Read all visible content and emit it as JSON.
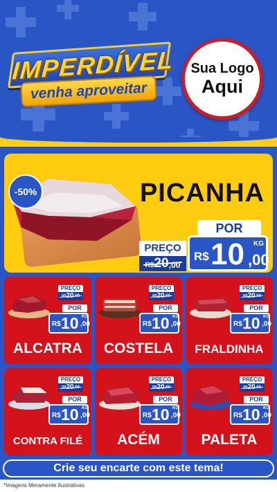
{
  "header": {
    "brand_title": "IMPERDÍVEL",
    "brand_subtitle": "venha aproveitar",
    "logo_line1": "Sua Logo",
    "logo_line2": "Aqui"
  },
  "featured": {
    "name": "PICANHA",
    "discount": "-50%",
    "price_label": "PREÇO",
    "old_currency": "R$",
    "old_integer": "20",
    "old_decimal": ",00",
    "por_label": "POR",
    "new_currency": "R$",
    "new_integer": "10",
    "new_decimal": ",00",
    "unit": "KG"
  },
  "products": [
    {
      "name": "ALCATRA",
      "price_label": "PREÇO",
      "old_currency": "R$",
      "old_integer": "20",
      "old_decimal": ",00",
      "por_label": "POR",
      "new_currency": "R$",
      "new_integer": "10",
      "new_decimal": ",00",
      "unit": "KG"
    },
    {
      "name": "COSTELA",
      "price_label": "PREÇO",
      "old_currency": "R$",
      "old_integer": "20",
      "old_decimal": ",00",
      "por_label": "POR",
      "new_currency": "R$",
      "new_integer": "10",
      "new_decimal": ",00",
      "unit": "KG"
    },
    {
      "name": "FRALDINHA",
      "price_label": "PREÇO",
      "old_currency": "R$",
      "old_integer": "20",
      "old_decimal": ",00",
      "por_label": "POR",
      "new_currency": "R$",
      "new_integer": "10",
      "new_decimal": ",00",
      "unit": "KG"
    },
    {
      "name": "CONTRA FILÉ",
      "price_label": "PREÇO",
      "old_currency": "R$",
      "old_integer": "20",
      "old_decimal": ",00",
      "por_label": "POR",
      "new_currency": "R$",
      "new_integer": "10",
      "new_decimal": ",00",
      "unit": "KG"
    },
    {
      "name": "ACÉM",
      "price_label": "PREÇO",
      "old_currency": "R$",
      "old_integer": "20",
      "old_decimal": ",00",
      "por_label": "POR",
      "new_currency": "R$",
      "new_integer": "10",
      "new_decimal": ",00",
      "unit": "KG"
    },
    {
      "name": "PALETA",
      "price_label": "PREÇO",
      "old_currency": "R$",
      "old_integer": "20",
      "old_decimal": ",00",
      "por_label": "POR",
      "new_currency": "R$",
      "new_integer": "10",
      "new_decimal": ",00",
      "unit": "KG"
    }
  ],
  "cta": "Crie seu encarte com este tema!",
  "footer_note": "*Imagens Meramente Ilustrativas",
  "colors": {
    "blue": "#2a55c5",
    "yellow": "#ffcc10",
    "red": "#d4121b",
    "dark_blue": "#1c3c9c"
  },
  "icons": [
    "plus-decoration-icon",
    "meat-icon"
  ]
}
